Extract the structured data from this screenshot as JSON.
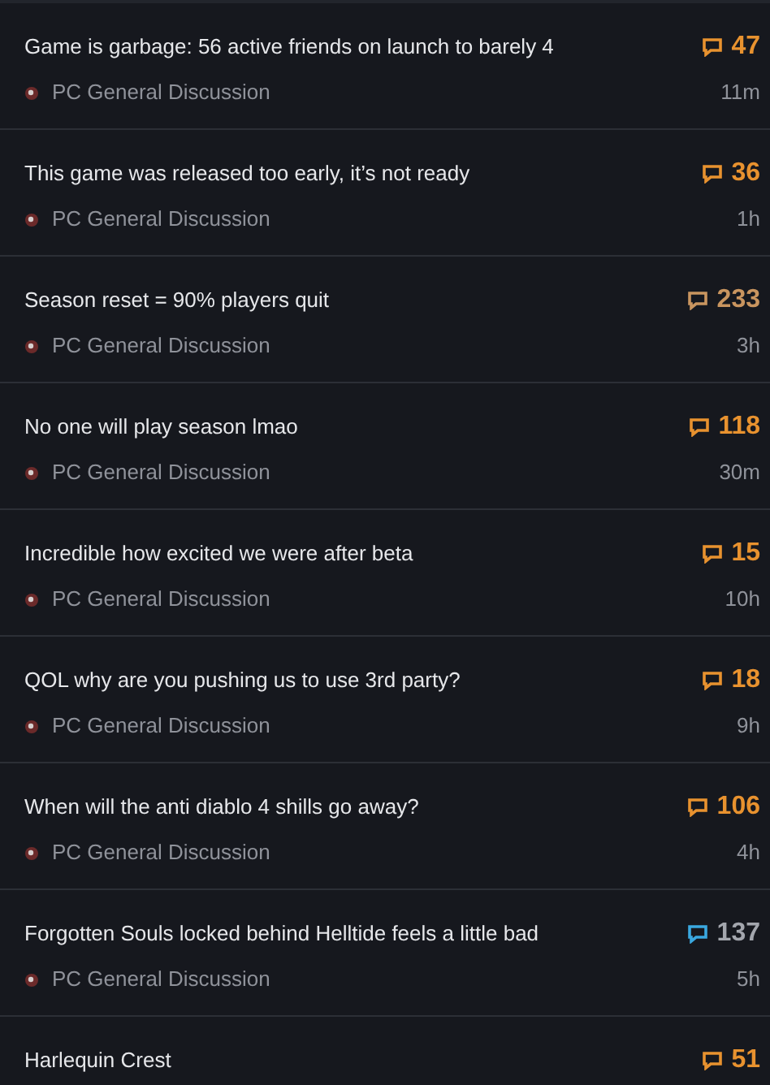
{
  "posts": [
    {
      "title": "Game is garbage: 56 active friends on launch to barely 4",
      "forum": "PC General Discussion",
      "replies": "47",
      "time": "11m",
      "color": "#e8922f",
      "muted": false
    },
    {
      "title": "This game was released too early, it’s not ready",
      "forum": "PC General Discussion",
      "replies": "36",
      "time": "1h",
      "color": "#e8922f",
      "muted": false
    },
    {
      "title": "Season reset = 90% players quit",
      "forum": "PC General Discussion",
      "replies": "233",
      "time": "3h",
      "color": "#c9955f",
      "muted": false
    },
    {
      "title": "No one will play season lmao",
      "forum": "PC General Discussion",
      "replies": "118",
      "time": "30m",
      "color": "#e8922f",
      "muted": false
    },
    {
      "title": "Incredible how excited we were after beta",
      "forum": "PC General Discussion",
      "replies": "15",
      "time": "10h",
      "color": "#e8922f",
      "muted": false
    },
    {
      "title": "QOL why are you pushing us to use 3rd party?",
      "forum": "PC General Discussion",
      "replies": "18",
      "time": "9h",
      "color": "#e8922f",
      "muted": false
    },
    {
      "title": "When will the anti diablo 4 shills go away?",
      "forum": "PC General Discussion",
      "replies": "106",
      "time": "4h",
      "color": "#e8922f",
      "muted": false
    },
    {
      "title": "Forgotten Souls locked behind Helltide feels a little bad",
      "forum": "PC General Discussion",
      "replies": "137",
      "time": "5h",
      "color": "#3aa8e0",
      "muted": true
    },
    {
      "title": "Harlequin Crest",
      "replies": "51",
      "color": "#e8922f",
      "muted": false
    }
  ]
}
